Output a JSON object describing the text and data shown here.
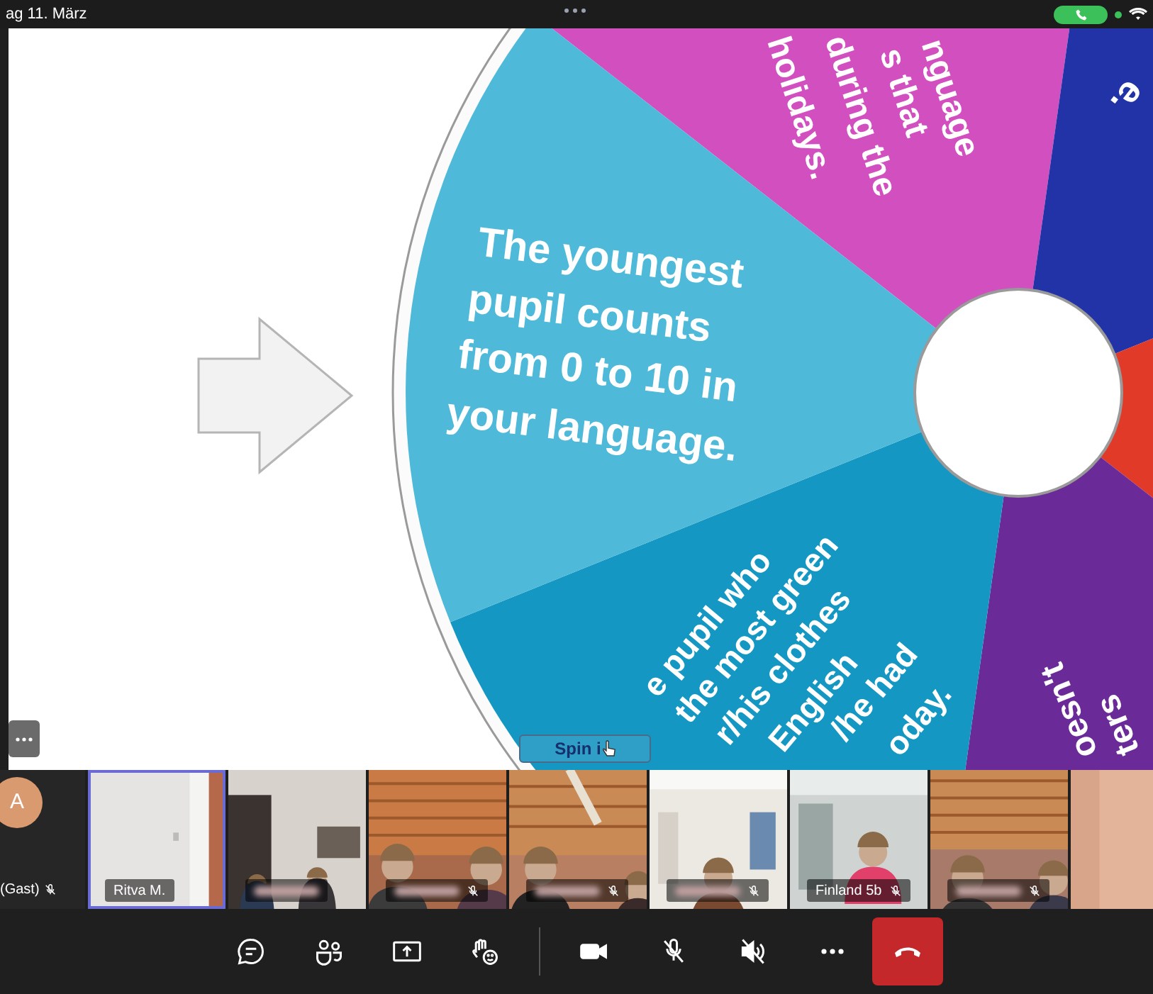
{
  "status_bar": {
    "date": "ag 11. März",
    "call_active": true
  },
  "shared_screen": {
    "wheel_segments": [
      {
        "color": "#d14fbf",
        "lines": [
          "nguage",
          "s that",
          "during the",
          "holidays."
        ]
      },
      {
        "color": "#2133a6",
        "lines": [
          "e."
        ]
      },
      {
        "color": "#e23a28"
      },
      {
        "color": "#6a2b98",
        "lines": [
          "oesn't",
          "ters"
        ]
      },
      {
        "color": "#1497c2",
        "lines": [
          "e pupil who",
          "the most green",
          "r/his clothes",
          "English",
          "/he had",
          "oday."
        ]
      },
      {
        "color": "#4fb9d9",
        "lines": [
          "The youngest",
          "pupil counts",
          "from 0 to 10 in",
          "your language."
        ]
      }
    ],
    "spin_button": "Spin i"
  },
  "guest": {
    "initial": "A",
    "name": "(Gast)",
    "muted": true
  },
  "tiles": [
    {
      "name": "Ritva M.",
      "selected": true,
      "muted": false
    },
    {
      "redacted": true,
      "selected": false,
      "muted": false
    },
    {
      "redacted": true,
      "selected": false,
      "muted": true
    },
    {
      "redacted": true,
      "selected": false,
      "muted": true
    },
    {
      "redacted": true,
      "selected": false,
      "muted": true
    },
    {
      "name": "Finland 5b",
      "selected": false,
      "muted": true
    },
    {
      "redacted": true,
      "selected": false,
      "muted": true
    },
    {
      "selected": false,
      "muted": false
    }
  ],
  "toolbar": {
    "mic_muted": true,
    "speaker_muted": true
  }
}
